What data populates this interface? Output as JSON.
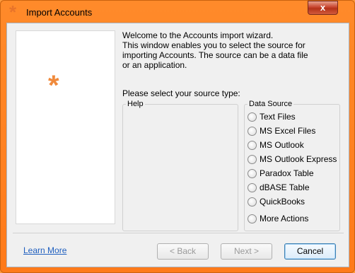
{
  "window": {
    "title": "Import Accounts",
    "close_label": "x",
    "app_icon": "asterisk-icon"
  },
  "welcome": {
    "line1": "Welcome to the Accounts import wizard.",
    "line2": "This window enables you to select the source for",
    "line3": "importing Accounts. The source can be a data file",
    "line4": "or an application."
  },
  "prompt": "Please select your source type:",
  "help": {
    "legend": "Help"
  },
  "data_source": {
    "legend": "Data Source",
    "options": [
      "Text Files",
      "MS Excel Files",
      "MS Outlook",
      "MS Outlook Express",
      "Paradox Table",
      "dBASE Table",
      "QuickBooks",
      "More Actions"
    ]
  },
  "footer": {
    "learn_more": "Learn More",
    "back": "< Back",
    "next": "Next >",
    "cancel": "Cancel"
  },
  "colors": {
    "frame": "#ff8a2a",
    "accent_icon": "#f08a3c",
    "link": "#1f5fbf"
  }
}
